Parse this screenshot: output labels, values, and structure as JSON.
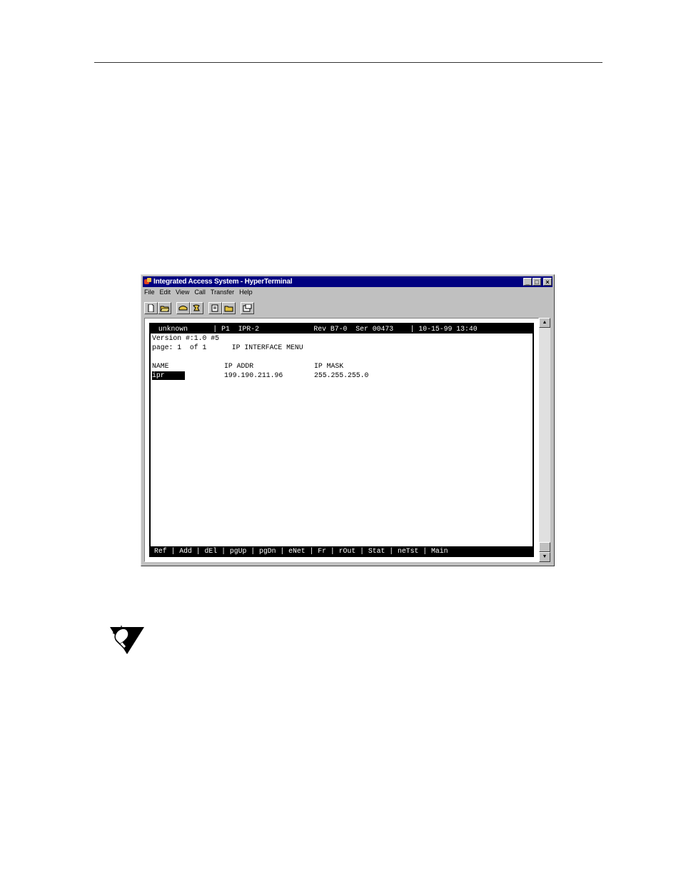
{
  "window": {
    "title": "Integrated Access System - HyperTerminal",
    "buttons": {
      "minimize": "_",
      "maximize": "□",
      "close": "×"
    }
  },
  "menubar": {
    "items": [
      {
        "label": "File"
      },
      {
        "label": "Edit"
      },
      {
        "label": "View"
      },
      {
        "label": "Call"
      },
      {
        "label": "Transfer"
      },
      {
        "label": "Help"
      }
    ]
  },
  "toolbar": {
    "icons": [
      "new-icon",
      "open-icon",
      "connect-icon",
      "disconnect-icon",
      "send-icon",
      "receive-icon",
      "properties-icon"
    ]
  },
  "terminal": {
    "status": " unknown      | P1  IPR-2             Rev B7-0  Ser 00473    | 10-15-99 13:40",
    "version": "Version #:1.0 #5",
    "page_line": "page: 1  of 1      IP INTERFACE MENU",
    "headers": {
      "name": "NAME",
      "ip_addr": "IP ADDR",
      "ip_mask": "IP MASK"
    },
    "rows": [
      {
        "name": "ipr",
        "ip_addr": "199.190.211.96",
        "ip_mask": "255.255.255.0"
      }
    ],
    "commands": "Ref | Add | dEl | pgUp | pgDn | eNet | Fr | rOut | Stat | neTst | Main"
  },
  "colors": {
    "titlebar": "#000080",
    "chrome": "#c0c0c0"
  }
}
